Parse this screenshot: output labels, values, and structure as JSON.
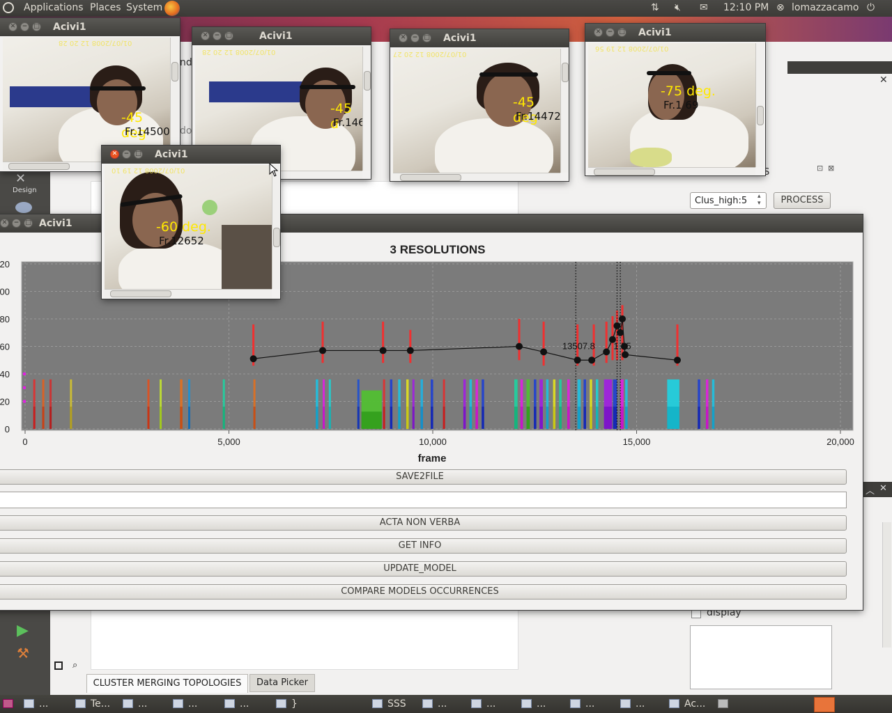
{
  "top_panel": {
    "menus": [
      "Applications",
      "Places",
      "System"
    ],
    "clock": "12:10 PM",
    "user": "lomazzacamo"
  },
  "video_windows": [
    {
      "title": "Acivi1",
      "degree": "-45 deg",
      "frame": "Fr.14500",
      "timestamp": "01/07/2008 12 20 28"
    },
    {
      "title": "Acivi1",
      "degree": "-45 d",
      "frame": "Fr.146",
      "timestamp": "01/07/2008 12 20 28"
    },
    {
      "title": "Acivi1",
      "degree": "-45 deg",
      "frame": "Fr.14472",
      "timestamp": "01/07/2008 12 20 27"
    },
    {
      "title": "Acivi1",
      "degree": "-75 deg.",
      "frame": "Fr.1 69",
      "timestamp": "01/07/2008 12 19 56"
    },
    {
      "title": "Acivi1",
      "degree": "-60 deg.",
      "frame": "Fr.12652",
      "timestamp": "01/07/2008 12 19 10"
    }
  ],
  "background_app": {
    "design_label": "Design",
    "combo_value": "Clus_high:5",
    "process_button": "PROCESS",
    "display_checkbox": "display",
    "tabs": [
      "CLUSTER MERGING TOPOLOGIES",
      "Data Picker"
    ],
    "partial_text_1": "ndo",
    "partial_text_2": "do",
    "partial_text_3": "S"
  },
  "main_window": {
    "title": "Acivi1",
    "buttons": {
      "save": "SAVE2FILE",
      "acta": "ACTA NON VERBA",
      "info": "GET INFO",
      "update": "UPDATE_MODEL",
      "compare": "COMPARE MODELS OCCURRENCES"
    }
  },
  "chart_data": {
    "type": "line",
    "title": "3 RESOLUTIONS",
    "xlabel": "frame",
    "ylabel": "",
    "xlim": [
      0,
      20000
    ],
    "ylim": [
      0,
      120
    ],
    "x_ticks": [
      "0",
      "5,000",
      "10,000",
      "15,000",
      "20,000"
    ],
    "y_ticks": [
      "0",
      "20",
      "40",
      "60",
      "80",
      "100",
      "120"
    ],
    "y_tick_labels_visible": [
      "0",
      "20",
      "40",
      "60",
      "80",
      "00",
      "20"
    ],
    "grid": true,
    "annotations": [
      {
        "text": "13507.8",
        "x": 13580,
        "y": 58
      },
      {
        "text": "1 75",
        "x": 14650,
        "y": 58
      }
    ],
    "vertical_markers": [
      13507.8,
      14520,
      14600
    ],
    "line_series": {
      "x": [
        5600,
        7300,
        8780,
        9450,
        12120,
        12720,
        13550,
        13900,
        14260,
        14410,
        14520,
        14600,
        14650,
        14700,
        14720,
        16000
      ],
      "y": [
        51,
        57,
        57,
        57,
        60,
        56,
        50,
        50,
        56,
        65,
        75,
        70,
        80,
        60,
        54,
        50
      ]
    },
    "red_error_bars": [
      {
        "x": 5600,
        "low": 46,
        "high": 76
      },
      {
        "x": 7300,
        "low": 48,
        "high": 78
      },
      {
        "x": 8780,
        "low": 48,
        "high": 78
      },
      {
        "x": 9450,
        "low": 48,
        "high": 72
      },
      {
        "x": 12120,
        "low": 50,
        "high": 80
      },
      {
        "x": 12720,
        "low": 46,
        "high": 78
      },
      {
        "x": 13550,
        "low": 46,
        "high": 76
      },
      {
        "x": 13950,
        "low": 46,
        "high": 76
      },
      {
        "x": 14260,
        "low": 48,
        "high": 78
      },
      {
        "x": 14410,
        "low": 50,
        "high": 82
      },
      {
        "x": 14520,
        "low": 50,
        "high": 86
      },
      {
        "x": 14650,
        "low": 50,
        "high": 90
      },
      {
        "x": 16000,
        "low": 46,
        "high": 76
      }
    ],
    "bars": [
      {
        "x": 200,
        "w": 40,
        "color": "#e03030",
        "h": 36
      },
      {
        "x": 420,
        "w": 30,
        "color": "#e06020",
        "h": 36
      },
      {
        "x": 600,
        "w": 25,
        "color": "#d03030",
        "h": 36
      },
      {
        "x": 1100,
        "w": 25,
        "color": "#d0c030",
        "h": 36
      },
      {
        "x": 3000,
        "w": 30,
        "color": "#e05020",
        "h": 36
      },
      {
        "x": 3300,
        "w": 40,
        "color": "#c0e030",
        "h": 36
      },
      {
        "x": 3800,
        "w": 60,
        "color": "#e07020",
        "h": 36
      },
      {
        "x": 4000,
        "w": 40,
        "color": "#2090d0",
        "h": 36
      },
      {
        "x": 4850,
        "w": 50,
        "color": "#20d0a0",
        "h": 36
      },
      {
        "x": 5600,
        "w": 40,
        "color": "#e07020",
        "h": 36
      },
      {
        "x": 7130,
        "w": 60,
        "color": "#20c0e0",
        "h": 36
      },
      {
        "x": 7300,
        "w": 40,
        "color": "#e020e0",
        "h": 36
      },
      {
        "x": 7450,
        "w": 40,
        "color": "#20d0d0",
        "h": 36
      },
      {
        "x": 8150,
        "w": 40,
        "color": "#2050d0",
        "h": 36
      },
      {
        "x": 8250,
        "w": 500,
        "color": "#50c030",
        "h": 28
      },
      {
        "x": 8780,
        "w": 40,
        "color": "#e03030",
        "h": 36
      },
      {
        "x": 8950,
        "w": 60,
        "color": "#2040d0",
        "h": 36
      },
      {
        "x": 9150,
        "w": 60,
        "color": "#20c0e0",
        "h": 36
      },
      {
        "x": 9350,
        "w": 60,
        "color": "#e0e020",
        "h": 36
      },
      {
        "x": 9500,
        "w": 40,
        "color": "#a020e0",
        "h": 36
      },
      {
        "x": 9700,
        "w": 60,
        "color": "#20b0e0",
        "h": 36
      },
      {
        "x": 9950,
        "w": 60,
        "color": "#2040d0",
        "h": 36
      },
      {
        "x": 10250,
        "w": 40,
        "color": "#e03030",
        "h": 36
      },
      {
        "x": 10750,
        "w": 60,
        "color": "#a020e0",
        "h": 36
      },
      {
        "x": 10900,
        "w": 60,
        "color": "#20c0e0",
        "h": 36
      },
      {
        "x": 11050,
        "w": 60,
        "color": "#e020e0",
        "h": 36
      },
      {
        "x": 11200,
        "w": 60,
        "color": "#2040d0",
        "h": 36
      },
      {
        "x": 12000,
        "w": 80,
        "color": "#20d0a0",
        "h": 36
      },
      {
        "x": 12150,
        "w": 60,
        "color": "#e020e0",
        "h": 36
      },
      {
        "x": 12300,
        "w": 80,
        "color": "#50c030",
        "h": 36
      },
      {
        "x": 12480,
        "w": 60,
        "color": "#2040d0",
        "h": 36
      },
      {
        "x": 12620,
        "w": 80,
        "color": "#a020e0",
        "h": 36
      },
      {
        "x": 12780,
        "w": 60,
        "color": "#20c0e0",
        "h": 36
      },
      {
        "x": 12950,
        "w": 60,
        "color": "#e0e020",
        "h": 36
      },
      {
        "x": 13100,
        "w": 60,
        "color": "#20d0a0",
        "h": 36
      },
      {
        "x": 13300,
        "w": 60,
        "color": "#e020e0",
        "h": 36
      },
      {
        "x": 13550,
        "w": 80,
        "color": "#20c0e0",
        "h": 36
      },
      {
        "x": 13700,
        "w": 60,
        "color": "#2040d0",
        "h": 36
      },
      {
        "x": 13850,
        "w": 60,
        "color": "#e0e020",
        "h": 36
      },
      {
        "x": 14000,
        "w": 60,
        "color": "#20d0d0",
        "h": 36
      },
      {
        "x": 14200,
        "w": 200,
        "color": "#a020e0",
        "h": 36
      },
      {
        "x": 14420,
        "w": 100,
        "color": "#2040d0",
        "h": 36
      },
      {
        "x": 14600,
        "w": 80,
        "color": "#e020e0",
        "h": 36
      },
      {
        "x": 14720,
        "w": 60,
        "color": "#20c0e0",
        "h": 36
      },
      {
        "x": 15750,
        "w": 300,
        "color": "#20d0e0",
        "h": 36
      },
      {
        "x": 16500,
        "w": 60,
        "color": "#2040d0",
        "h": 36
      },
      {
        "x": 16700,
        "w": 60,
        "color": "#e020e0",
        "h": 36
      },
      {
        "x": 16850,
        "w": 60,
        "color": "#20c0e0",
        "h": 36
      }
    ]
  },
  "taskbar": {
    "items": [
      "...",
      "Te...",
      "...",
      "...",
      "...",
      "}",
      "SSS",
      "...",
      "...",
      "...",
      "...",
      "...",
      "Ac..."
    ]
  }
}
